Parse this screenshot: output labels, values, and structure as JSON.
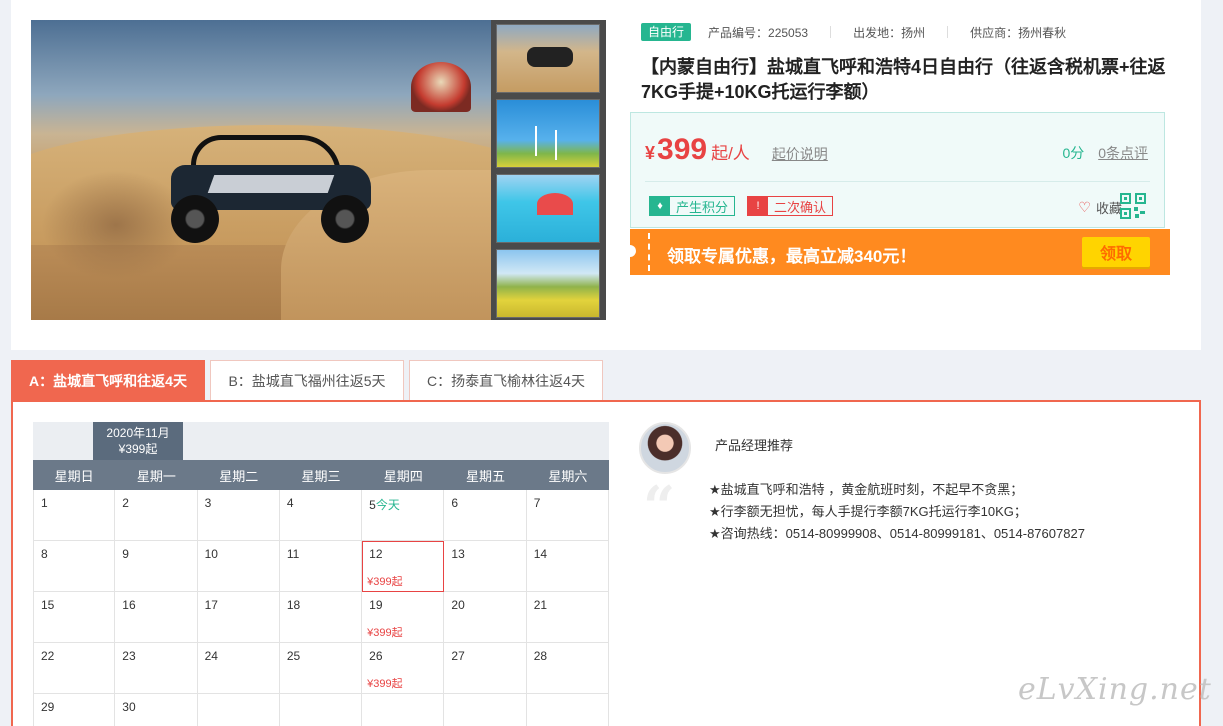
{
  "product": {
    "type_tag": "自由行",
    "code_label": "产品编号：225053",
    "departure_label": "出发地：扬州",
    "supplier_label": "供应商：扬州春秋",
    "title": "【内蒙自由行】盐城直飞呼和浩特4日自由行（往返含税机票+往返7KG手提+10KG托运行李额）"
  },
  "price": {
    "currency": "¥",
    "amount": "399",
    "unit": "起/人",
    "note": "起价说明",
    "score": "0分",
    "reviews": "0条点评",
    "badge_points": "产生积分",
    "badge_confirm": "二次确认",
    "favorite": "收藏"
  },
  "promo": {
    "text": "领取专属优惠，最高立减340元！",
    "button": "领取"
  },
  "tabs": [
    {
      "label": "A：盐城直飞呼和往返4天",
      "active": true
    },
    {
      "label": "B：盐城直飞福州往返5天",
      "active": false
    },
    {
      "label": "C：扬泰直飞榆林往返4天",
      "active": false
    }
  ],
  "calendar": {
    "month": "2020年11月",
    "month_price": "¥399起",
    "weekdays": [
      "星期日",
      "星期一",
      "星期二",
      "星期三",
      "星期四",
      "星期五",
      "星期六"
    ],
    "cells": [
      {
        "d": "1"
      },
      {
        "d": "2"
      },
      {
        "d": "3"
      },
      {
        "d": "4"
      },
      {
        "d": "5",
        "today": "今天"
      },
      {
        "d": "6"
      },
      {
        "d": "7"
      },
      {
        "d": "8"
      },
      {
        "d": "9"
      },
      {
        "d": "10"
      },
      {
        "d": "11"
      },
      {
        "d": "12",
        "price": "¥399起",
        "selected": true
      },
      {
        "d": "13"
      },
      {
        "d": "14"
      },
      {
        "d": "15"
      },
      {
        "d": "16"
      },
      {
        "d": "17"
      },
      {
        "d": "18"
      },
      {
        "d": "19",
        "price": "¥399起"
      },
      {
        "d": "20"
      },
      {
        "d": "21"
      },
      {
        "d": "22"
      },
      {
        "d": "23"
      },
      {
        "d": "24"
      },
      {
        "d": "25"
      },
      {
        "d": "26",
        "price": "¥399起"
      },
      {
        "d": "27"
      },
      {
        "d": "28"
      },
      {
        "d": "29"
      },
      {
        "d": "30"
      },
      {
        "d": ""
      },
      {
        "d": ""
      },
      {
        "d": ""
      },
      {
        "d": ""
      },
      {
        "d": ""
      }
    ]
  },
  "manager": {
    "title": "产品经理推荐",
    "lines": [
      "★盐城直飞呼和浩特 ，黄金航班时刻，不起早不贪黑；",
      "★行李额无担忧，每人手提行李额7KG托运行李10KG；",
      "★咨询热线：0514-80999908、0514-80999181、0514-87607827"
    ]
  },
  "watermark": "eLvXing.net",
  "colors": {
    "accent_green": "#26b690",
    "price_red": "#e84343",
    "promo_orange": "#ff8a1f",
    "tab_active": "#f0674f"
  }
}
